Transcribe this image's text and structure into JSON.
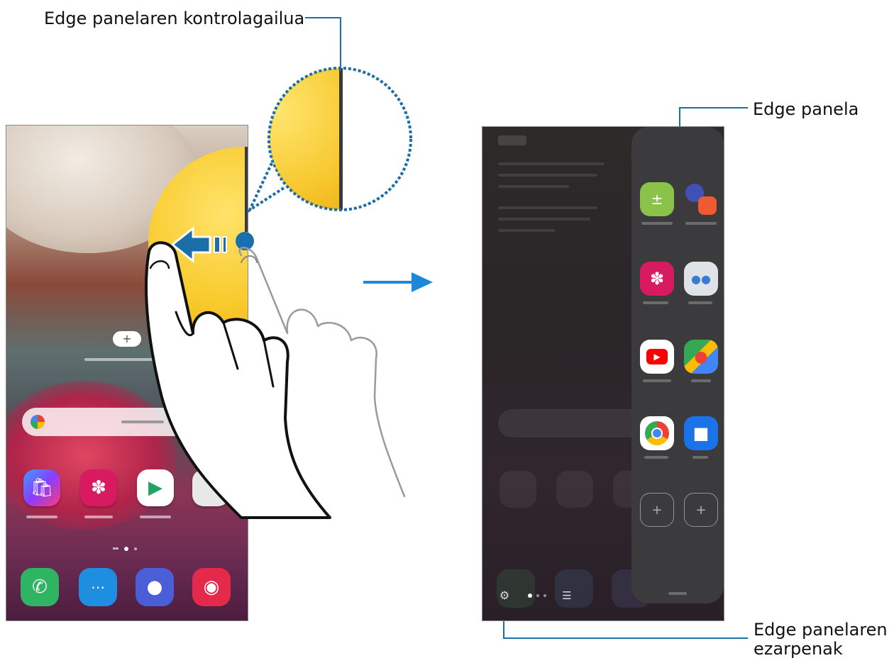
{
  "callouts": {
    "controller": "Edge panelaren kontrolagailua",
    "panel": "Edge panela",
    "settings_line1": "Edge panelaren",
    "settings_line2": "ezarpenak"
  },
  "colors": {
    "callout_line": "#1b6ea8",
    "arrow": "#1e88d8",
    "handle": "#1a6fb0"
  },
  "left_phone": {
    "home_apps": [
      "shopping-bag-icon",
      "flower-icon",
      "play-store-icon",
      "google-folder-icon"
    ],
    "dock_apps": [
      "phone-icon",
      "messages-icon",
      "internet-icon",
      "camera-icon"
    ]
  },
  "right_phone": {
    "panel_apps": [
      "calculator-icon",
      "internet-notes-icon",
      "gallery-icon",
      "folder-icon",
      "youtube-icon",
      "maps-icon",
      "chrome-icon",
      "duo-icon",
      "add-icon",
      "add-icon"
    ]
  }
}
